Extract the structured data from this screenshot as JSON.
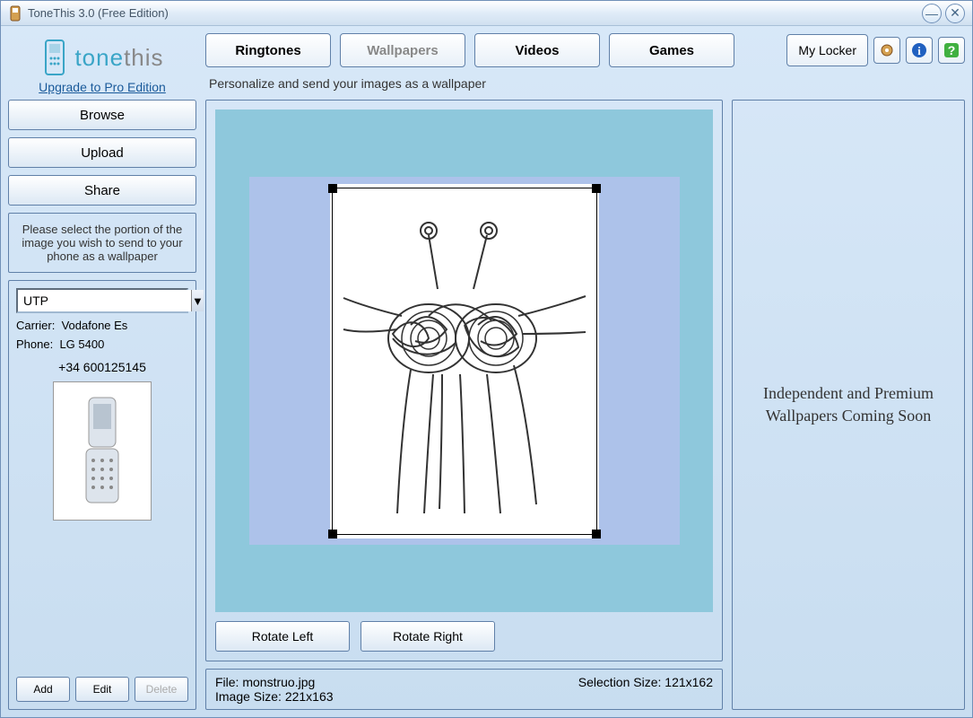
{
  "window": {
    "title": "ToneThis 3.0 (Free Edition)"
  },
  "logo": {
    "part1": "tone",
    "part2": "this",
    "upgrade": "Upgrade to Pro Edition"
  },
  "tabs": {
    "ringtones": "Ringtones",
    "wallpapers": "Wallpapers",
    "videos": "Videos",
    "games": "Games"
  },
  "toolbar": {
    "mylocker": "My Locker"
  },
  "subtitle": "Personalize and send your images as a wallpaper",
  "sidebar": {
    "browse": "Browse",
    "upload": "Upload",
    "share": "Share",
    "help": "Please select the portion of the image you wish to send to your phone as a wallpaper"
  },
  "phone": {
    "carrier_sel": "UTP",
    "carrier_label": "Carrier:",
    "carrier_val": "Vodafone Es",
    "phone_label": "Phone:",
    "phone_val": "LG 5400",
    "number": "+34 600125145",
    "add": "Add",
    "edit": "Edit",
    "delete": "Delete"
  },
  "editor": {
    "rotate_left": "Rotate Left",
    "rotate_right": "Rotate Right"
  },
  "status": {
    "file_label": "File:",
    "file_val": "monstruo.jpg",
    "imgsize_label": "Image Size:",
    "imgsize_val": "221x163",
    "selsize_label": "Selection Size:",
    "selsize_val": "121x162"
  },
  "rightpanel": "Independent and Premium Wallpapers Coming Soon"
}
